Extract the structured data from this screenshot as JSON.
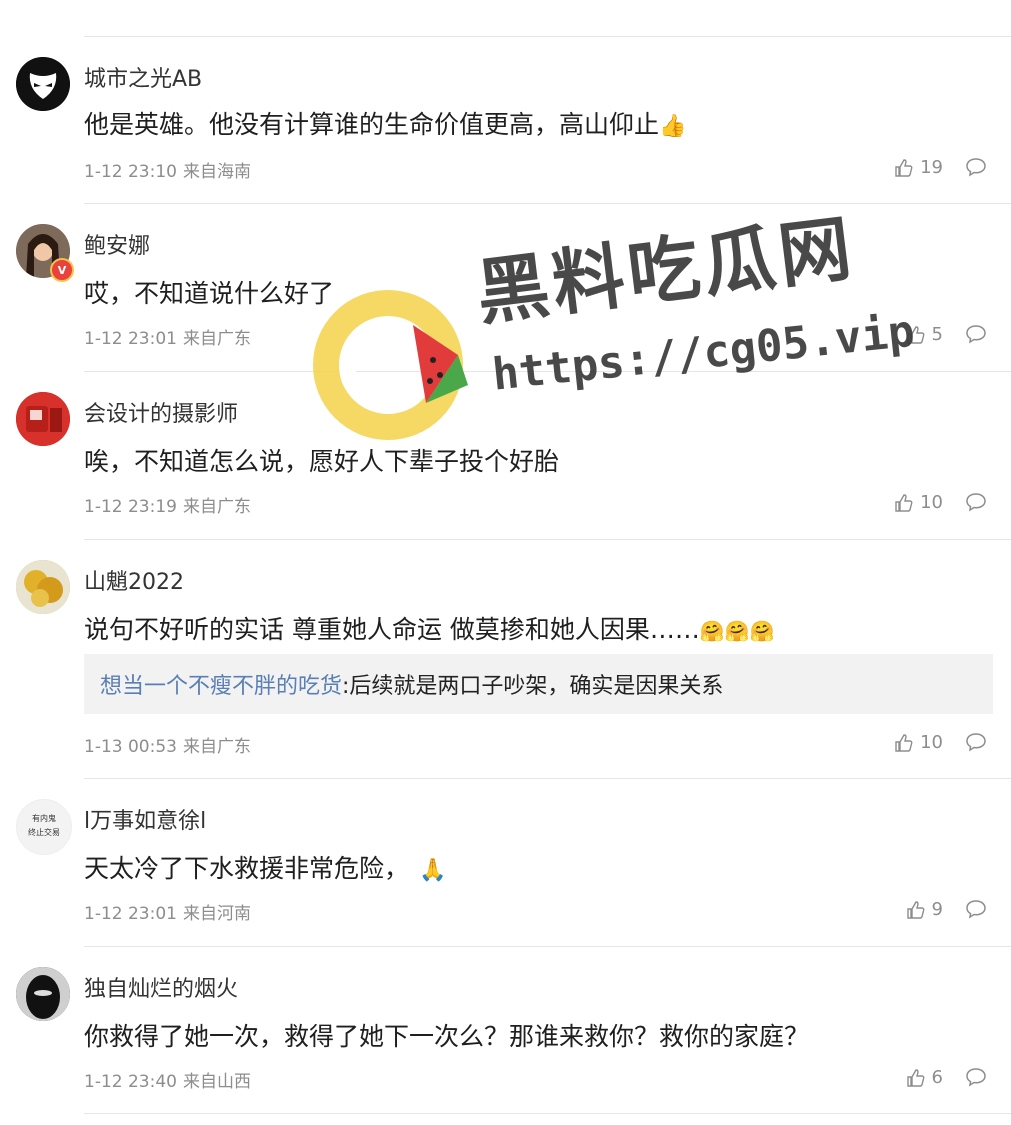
{
  "comments": [
    {
      "name": "城市之光AB",
      "text": "他是英雄。他没有计算谁的生命价值更高，高山仰止",
      "emoji": "👍",
      "time": "1-12 23:10",
      "location": "来自海南",
      "likes": "19"
    },
    {
      "name": "鲍安娜",
      "text": "哎，不知道说什么好了",
      "time": "1-12 23:01",
      "location": "来自广东",
      "likes": "5",
      "verified": "V"
    },
    {
      "name": "会设计的摄影师",
      "text": "唉，不知道怎么说，愿好人下辈子投个好胎",
      "time": "1-12 23:19",
      "location": "来自广东",
      "likes": "10"
    },
    {
      "name": "山魈2022",
      "text": "说句不好听的实话 尊重她人命运 做莫掺和她人因果……",
      "emoji": "🤗🤗🤗",
      "time": "1-13 00:53",
      "location": "来自广东",
      "likes": "10",
      "reply": {
        "name": "想当一个不瘦不胖的吃货",
        "text": ":后续就是两口子吵架，确实是因果关系"
      }
    },
    {
      "name": "l万事如意徐l",
      "text": "天太冷了下水救援非常危险，",
      "emoji": "🙏",
      "time": "1-12 23:01",
      "location": "来自河南",
      "likes": "9",
      "avatar_text": "有内鬼\n终止交易"
    },
    {
      "name": "独自灿烂的烟火",
      "text": "你救得了她一次，救得了她下一次么？那谁来救你？救你的家庭？",
      "time": "1-12 23:40",
      "location": "来自山西",
      "likes": "6"
    }
  ],
  "watermark": {
    "title": "黑料吃瓜网",
    "url": "https://cg05.vip"
  }
}
